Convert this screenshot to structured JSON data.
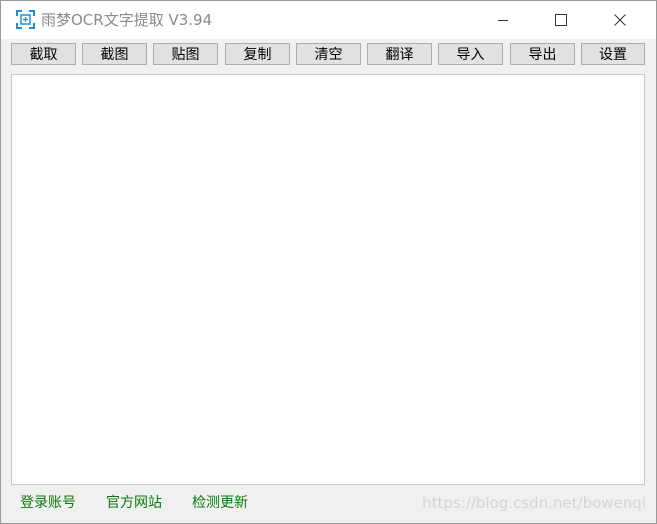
{
  "window": {
    "title": "雨梦OCR文字提取 V3.94",
    "icon": "screenshot-ocr-icon",
    "controls": {
      "minimize": "minimize-icon",
      "maximize": "maximize-icon",
      "close": "close-icon"
    }
  },
  "toolbar": {
    "buttons": [
      {
        "id": "capture",
        "label": "截取"
      },
      {
        "id": "screenshot",
        "label": "截图"
      },
      {
        "id": "paste-image",
        "label": "贴图"
      },
      {
        "id": "copy",
        "label": "复制"
      },
      {
        "id": "clear",
        "label": "清空"
      },
      {
        "id": "translate",
        "label": "翻译"
      },
      {
        "id": "import",
        "label": "导入"
      },
      {
        "id": "export",
        "label": "导出"
      },
      {
        "id": "settings",
        "label": "设置"
      }
    ]
  },
  "text_area": {
    "value": ""
  },
  "statusbar": {
    "links": [
      {
        "id": "login",
        "label": "登录账号"
      },
      {
        "id": "official-site",
        "label": "官方网站"
      },
      {
        "id": "check-update",
        "label": "检测更新"
      }
    ],
    "watermark": "https://blog.csdn.net/bowenqi"
  },
  "colors": {
    "link": "#0a7a0a",
    "icon_accent": "#1e8fd6",
    "button_face": "#e1e1e1",
    "window_bg": "#f0f0f0"
  }
}
